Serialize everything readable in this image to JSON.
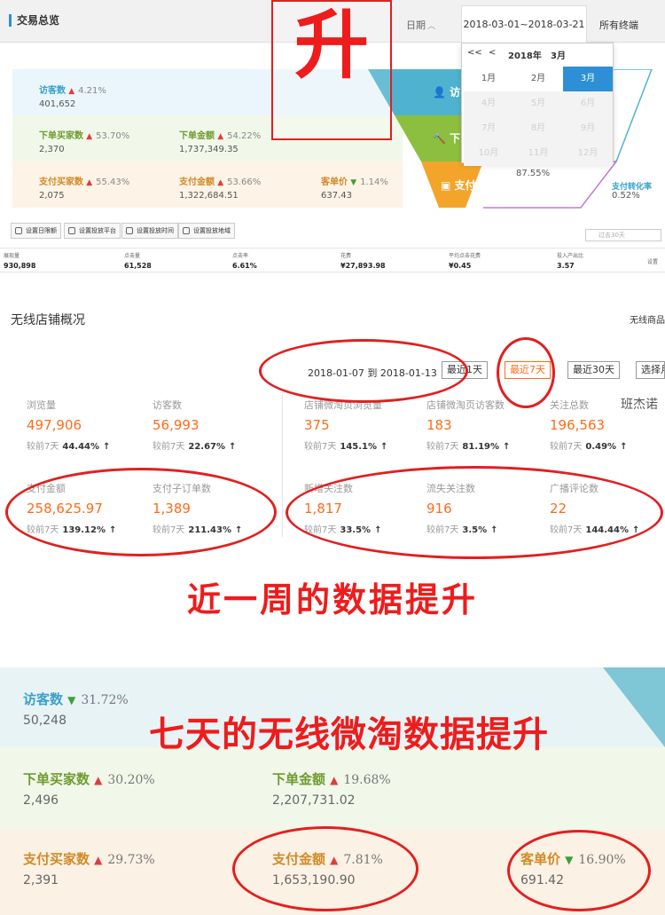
{
  "overview": {
    "title": "交易总览",
    "date_label": "日期",
    "date_range": "2018-03-01~2018-03-21",
    "terminal": "所有终端",
    "rise_char": "升",
    "calendar": {
      "prev_year": "<<",
      "prev": "<",
      "year": "2018年",
      "month": "3月",
      "months": [
        "1月",
        "2月",
        "3月",
        "4月",
        "5月",
        "6月",
        "7月",
        "8月",
        "9月",
        "10月",
        "11月",
        "12月"
      ],
      "selected": "3月"
    },
    "metrics": {
      "visitors": {
        "label": "访客数",
        "pct": "4.21%",
        "value": "401,652"
      },
      "order_buyers": {
        "label": "下单买家数",
        "pct": "53.70%",
        "value": "2,370"
      },
      "order_amount": {
        "label": "下单金额",
        "pct": "54.22%",
        "value": "1,737,349.35"
      },
      "pay_buyers": {
        "label": "支付买家数",
        "pct": "55.43%",
        "value": "2,075"
      },
      "pay_amount": {
        "label": "支付金额",
        "pct": "53.66%",
        "value": "1,322,684.51"
      },
      "unit_price": {
        "label": "客单价",
        "pct": "1.14%",
        "value": "637.43"
      }
    },
    "funnel": {
      "visit": "访",
      "order": "下",
      "pay": "支付",
      "rate1": "87.55%",
      "pay_conv_label": "支付转化率",
      "pay_conv": "0.52%"
    },
    "toolbar": [
      "设置日限额",
      "设置投放平台",
      "设置投放时间",
      "设置投放地域"
    ],
    "search_placeholder": "过去30天",
    "stats": [
      {
        "label": "展现量",
        "value": "930,898"
      },
      {
        "label": "点击量",
        "value": "61,528"
      },
      {
        "label": "点击率",
        "value": "6.61%"
      },
      {
        "label": "花费",
        "value": "¥27,893.98"
      },
      {
        "label": "平均点击花费",
        "value": "¥0.45"
      },
      {
        "label": "投入产出比",
        "value": "3.57"
      }
    ],
    "settings_label": "设置"
  },
  "mobile": {
    "title": "无线店铺概况",
    "link": "无线商品",
    "range": "2018-01-07 到 2018-01-13",
    "buttons": [
      "最近1天",
      "最近7天",
      "最近30天",
      "选择月"
    ],
    "active_button": "最近7天",
    "user": "班杰诺",
    "compare_label": "较前7天",
    "kpis": [
      {
        "label": "浏览量",
        "value": "497,906",
        "pct": "44.44%"
      },
      {
        "label": "访客数",
        "value": "56,993",
        "pct": "22.67%"
      },
      {
        "label": "店铺微淘页浏览量",
        "value": "375",
        "pct": "145.1%"
      },
      {
        "label": "店铺微淘页访客数",
        "value": "183",
        "pct": "81.19%"
      },
      {
        "label": "关注总数",
        "value": "196,563",
        "pct": "0.49%"
      },
      {
        "label": "支付金额",
        "value": "258,625.97",
        "pct": "139.12%"
      },
      {
        "label": "支付子订单数",
        "value": "1,389",
        "pct": "211.43%"
      },
      {
        "label": "新增关注数",
        "value": "1,817",
        "pct": "33.5%"
      },
      {
        "label": "流失关注数",
        "value": "916",
        "pct": "3.5%"
      },
      {
        "label": "广播评论数",
        "value": "22",
        "pct": "144.44%"
      }
    ],
    "caption": "近一周的数据提升"
  },
  "bottom": {
    "caption": "七天的无线微淘数据提升",
    "metrics": {
      "visitors": {
        "label": "访客数",
        "pct": "31.72%",
        "value": "50,248"
      },
      "order_buyers": {
        "label": "下单买家数",
        "pct": "30.20%",
        "value": "2,496"
      },
      "order_amount": {
        "label": "下单金额",
        "pct": "19.68%",
        "value": "2,207,731.02"
      },
      "pay_buyers": {
        "label": "支付买家数",
        "pct": "29.73%",
        "value": "2,391"
      },
      "pay_amount": {
        "label": "支付金额",
        "pct": "7.81%",
        "value": "1,653,190.90"
      },
      "unit_price": {
        "label": "客单价",
        "pct": "16.90%",
        "value": "691.42"
      }
    }
  },
  "icons": {
    "up": "up-arrow-icon",
    "down": "down-arrow-icon"
  },
  "colors": {
    "accent": "#ff6b1a",
    "annotation": "#ee1c1c",
    "link_blue": "#2d8fd5"
  }
}
